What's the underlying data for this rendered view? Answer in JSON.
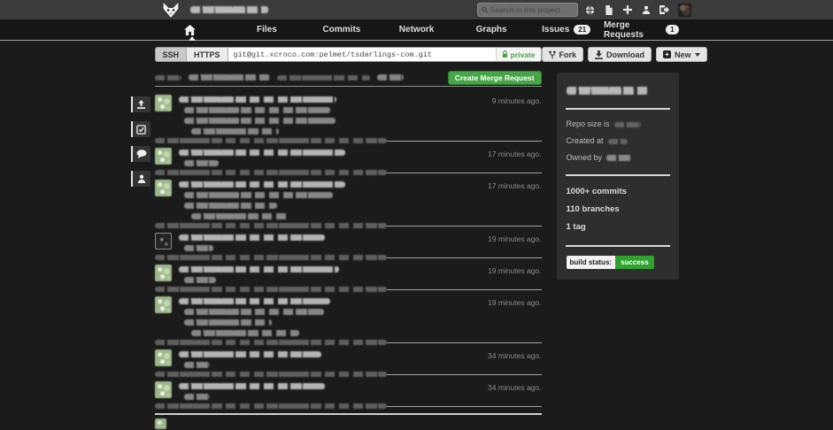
{
  "topbar": {
    "search_placeholder": "Search in this project"
  },
  "nav": {
    "tabs": [
      {
        "id": "home",
        "label": "",
        "icon": "home",
        "active": true,
        "badge": null
      },
      {
        "id": "files",
        "label": "Files",
        "active": false,
        "badge": null
      },
      {
        "id": "commits",
        "label": "Commits",
        "active": false,
        "badge": null
      },
      {
        "id": "network",
        "label": "Network",
        "active": false,
        "badge": null
      },
      {
        "id": "graphs",
        "label": "Graphs",
        "active": false,
        "badge": null
      },
      {
        "id": "issues",
        "label": "Issues",
        "active": false,
        "badge": "21"
      },
      {
        "id": "merge-requests",
        "label": "Merge Requests",
        "active": false,
        "badge": "1"
      }
    ]
  },
  "clone_bar": {
    "ssh_label": "SSH",
    "https_label": "HTTPS",
    "url": "git@git.xcroco.com:pelmet/tsdarlings-com.git",
    "visibility": "private"
  },
  "repo_actions": {
    "fork_label": "Fork",
    "download_label": "Download",
    "new_label": "New"
  },
  "feed_header": {
    "create_merge_request_label": "Create Merge Request",
    "scribble_widths": [
      7,
      21,
      24,
      7
    ]
  },
  "feed": {
    "separator_scribble_width": 60,
    "entries": [
      {
        "timestamp": "9 minutes ago.",
        "avatar": "solid",
        "line_widths": [
          54,
          50,
          52,
          30
        ]
      },
      {
        "timestamp": "17 minutes ago.",
        "avatar": "solid",
        "line_widths": [
          57,
          12
        ]
      },
      {
        "timestamp": "17 minutes ago.",
        "avatar": "solid",
        "line_widths": [
          57,
          51,
          32,
          34
        ]
      },
      {
        "timestamp": "19 minutes ago.",
        "avatar": "outline",
        "line_widths": [
          50,
          10
        ]
      },
      {
        "timestamp": "19 minutes ago.",
        "avatar": "solid",
        "line_widths": [
          55,
          11
        ]
      },
      {
        "timestamp": "19 minutes ago.",
        "avatar": "solid",
        "line_widths": [
          52,
          48,
          30,
          37
        ]
      },
      {
        "timestamp": "34 minutes ago.",
        "avatar": "solid",
        "line_widths": [
          49,
          9
        ]
      },
      {
        "timestamp": "34 minutes ago.",
        "avatar": "solid",
        "line_widths": [
          50,
          9
        ]
      }
    ]
  },
  "sidebar": {
    "repo_size_label": "Repo size is",
    "created_at_label": "Created at",
    "owned_by_label": "Owned by",
    "stats": [
      "1000+ commits",
      "110 branches",
      "1 tag"
    ],
    "build_status_label": "build status:",
    "build_status_value": "success",
    "colors": {
      "success": "#2ea12e",
      "create_mr_green": "#46a546"
    }
  }
}
